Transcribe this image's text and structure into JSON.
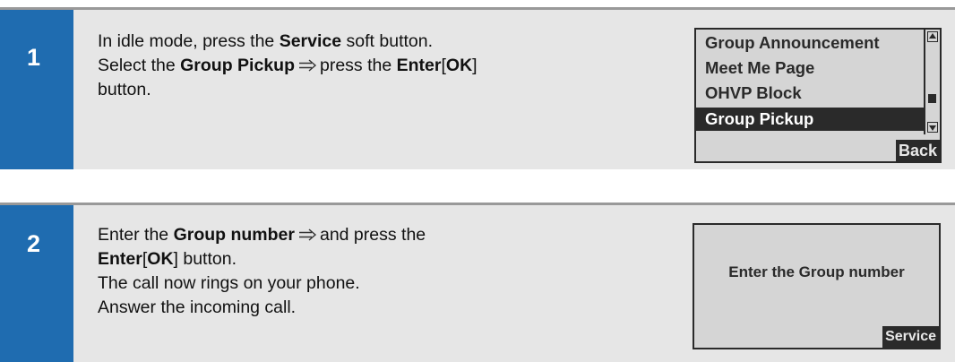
{
  "step1": {
    "number": "1",
    "line1": {
      "pre": "In idle mode, press the ",
      "bold": "Service",
      "post": " soft button."
    },
    "line2": {
      "pre": "Select the ",
      "bold1": "Group Pickup",
      "mid": "press the ",
      "bold2": "Enter",
      "bracket_open": "[",
      "bold3": "OK",
      "bracket_close": "]"
    },
    "line3": "button.",
    "screen": {
      "items": [
        "Group Announcement",
        "Meet Me Page",
        "OHVP Block",
        "Group Pickup"
      ],
      "selected_index": 3,
      "softkey": "Back"
    }
  },
  "step2": {
    "number": "2",
    "line1": {
      "pre": "Enter the ",
      "bold": "Group number",
      "post": "and press the"
    },
    "line2": {
      "bold1": "Enter",
      "bracket_open": "[",
      "bold2": "OK",
      "post": "] button."
    },
    "line3": "The call now rings on your phone.",
    "line4": "Answer the incoming call.",
    "screen": {
      "prompt": "Enter the Group number",
      "softkey": "Service"
    }
  },
  "icons": {
    "arrow": "double-right-arrow-icon"
  },
  "colors": {
    "accent": "#1f6cb0",
    "panel": "#e6e6e6",
    "lcd": "#d5d5d5"
  }
}
